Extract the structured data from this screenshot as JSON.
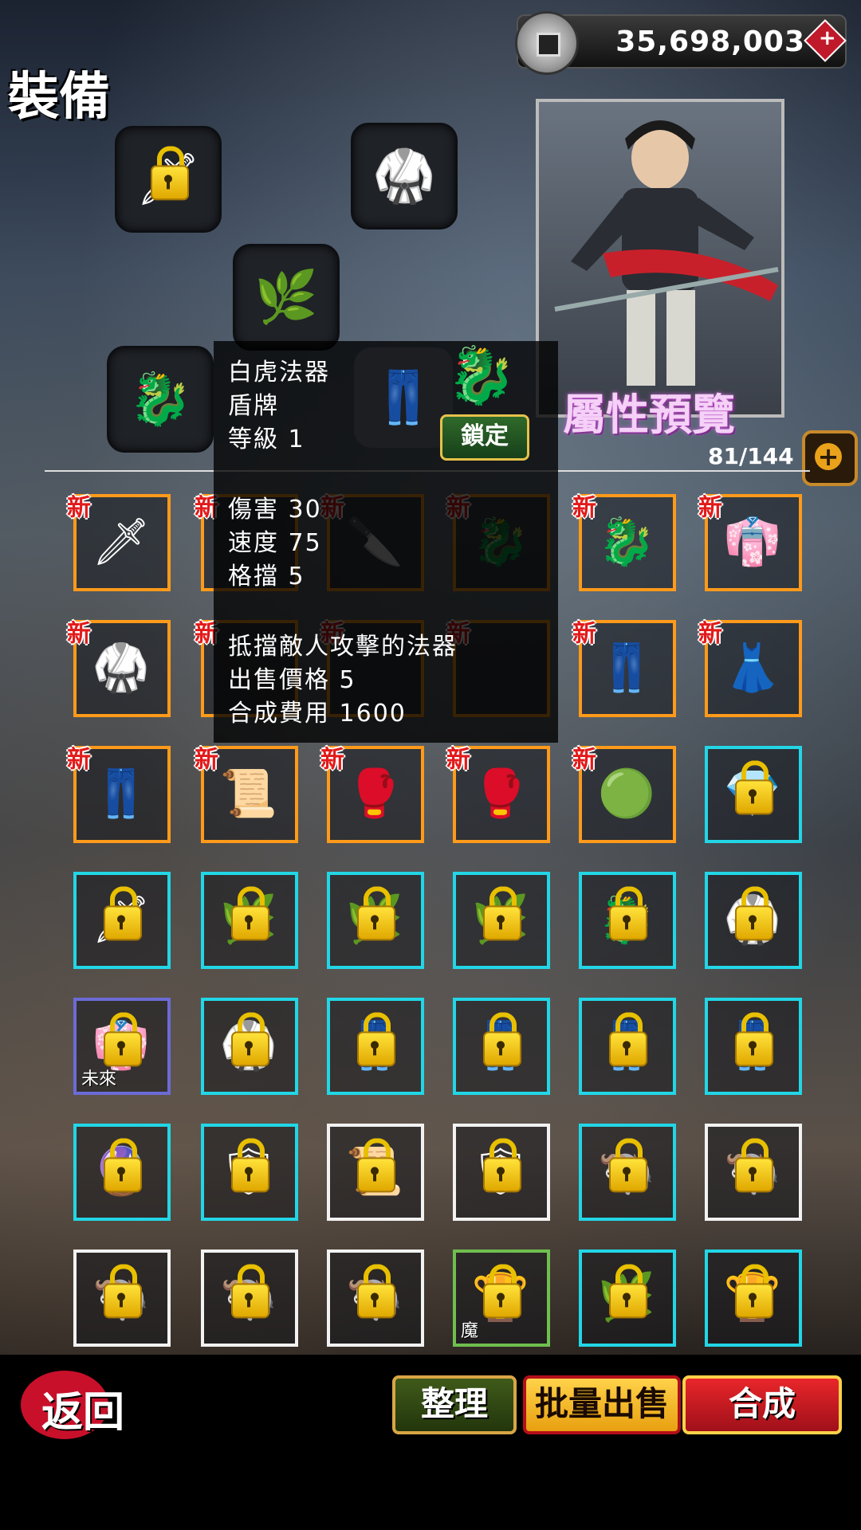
{
  "header": {
    "title": "裝備",
    "currency_value": "35,698,003",
    "currency_add_symbol": "+"
  },
  "equipped": {
    "slots": [
      {
        "icon": "claw-weapon-icon",
        "locked": true,
        "glyph": "🗡"
      },
      {
        "icon": "purple-armor-icon",
        "locked": false,
        "glyph": "🥋"
      },
      {
        "icon": "herb-icon",
        "locked": false,
        "glyph": "🌿"
      },
      {
        "icon": "tiger-talisman-icon",
        "locked": false,
        "glyph": "🐉"
      },
      {
        "icon": "pants-icon",
        "locked": false,
        "glyph": "👖"
      }
    ]
  },
  "hero": {
    "preview_label": "屬性預覽"
  },
  "inventory": {
    "capacity": "81/144",
    "expand_symbol": "+",
    "new_label": "新",
    "rows": [
      [
        {
          "rarity": "orange",
          "new": true,
          "locked": false,
          "icon": "spear-icon",
          "glyph": "🗡",
          "tag": ""
        },
        {
          "rarity": "orange",
          "new": true,
          "locked": false,
          "icon": "item-icon",
          "glyph": "",
          "tag": ""
        },
        {
          "rarity": "orange",
          "new": true,
          "locked": false,
          "icon": "curved-blade-icon",
          "glyph": "🔪",
          "tag": ""
        },
        {
          "rarity": "orange",
          "new": true,
          "locked": false,
          "icon": "tiger-talisman-icon",
          "glyph": "🐉",
          "tag": ""
        },
        {
          "rarity": "orange",
          "new": true,
          "locked": false,
          "icon": "tiger-talisman-icon",
          "glyph": "🐉",
          "tag": ""
        },
        {
          "rarity": "orange",
          "new": true,
          "locked": false,
          "icon": "robe-icon",
          "glyph": "👘",
          "tag": ""
        }
      ],
      [
        {
          "rarity": "orange",
          "new": true,
          "locked": false,
          "icon": "armor-icon",
          "glyph": "🥋",
          "tag": ""
        },
        {
          "rarity": "orange",
          "new": true,
          "locked": false,
          "icon": "item-icon",
          "glyph": "",
          "tag": ""
        },
        {
          "rarity": "orange",
          "new": true,
          "locked": false,
          "icon": "item-icon",
          "glyph": "",
          "tag": ""
        },
        {
          "rarity": "orange",
          "new": true,
          "locked": false,
          "icon": "item-icon",
          "glyph": "",
          "tag": ""
        },
        {
          "rarity": "orange",
          "new": true,
          "locked": false,
          "icon": "pants-icon",
          "glyph": "👖",
          "tag": ""
        },
        {
          "rarity": "orange",
          "new": true,
          "locked": false,
          "icon": "skirt-icon",
          "glyph": "👗",
          "tag": ""
        }
      ],
      [
        {
          "rarity": "orange",
          "new": true,
          "locked": false,
          "icon": "pants-icon",
          "glyph": "👖",
          "tag": ""
        },
        {
          "rarity": "orange",
          "new": true,
          "locked": false,
          "icon": "scroll-icon",
          "glyph": "📜",
          "tag": ""
        },
        {
          "rarity": "orange",
          "new": true,
          "locked": false,
          "icon": "gauntlet-icon",
          "glyph": "🥊",
          "tag": ""
        },
        {
          "rarity": "orange",
          "new": true,
          "locked": false,
          "icon": "gauntlet-icon",
          "glyph": "🥊",
          "tag": ""
        },
        {
          "rarity": "orange",
          "new": true,
          "locked": false,
          "icon": "orb-icon",
          "glyph": "🟢",
          "tag": ""
        },
        {
          "rarity": "cyan",
          "new": false,
          "locked": true,
          "icon": "gem-icon",
          "glyph": "💎",
          "tag": ""
        }
      ],
      [
        {
          "rarity": "cyan",
          "new": false,
          "locked": true,
          "icon": "claw-weapon-icon",
          "glyph": "🗡",
          "tag": ""
        },
        {
          "rarity": "cyan",
          "new": false,
          "locked": true,
          "icon": "herb-icon",
          "glyph": "🌿",
          "tag": ""
        },
        {
          "rarity": "cyan",
          "new": false,
          "locked": true,
          "icon": "herb-icon",
          "glyph": "🌿",
          "tag": ""
        },
        {
          "rarity": "cyan",
          "new": false,
          "locked": true,
          "icon": "herb-icon",
          "glyph": "🌿",
          "tag": ""
        },
        {
          "rarity": "cyan",
          "new": false,
          "locked": true,
          "icon": "tiger-talisman-icon",
          "glyph": "🐉",
          "tag": ""
        },
        {
          "rarity": "cyan",
          "new": false,
          "locked": true,
          "icon": "armor-icon",
          "glyph": "🥋",
          "tag": ""
        }
      ],
      [
        {
          "rarity": "purple",
          "new": false,
          "locked": true,
          "icon": "robe-icon",
          "glyph": "👘",
          "tag": "未來"
        },
        {
          "rarity": "cyan",
          "new": false,
          "locked": true,
          "icon": "armor-icon",
          "glyph": "🥋",
          "tag": ""
        },
        {
          "rarity": "cyan",
          "new": false,
          "locked": true,
          "icon": "pants-icon",
          "glyph": "👖",
          "tag": ""
        },
        {
          "rarity": "cyan",
          "new": false,
          "locked": true,
          "icon": "pants-icon",
          "glyph": "👖",
          "tag": ""
        },
        {
          "rarity": "cyan",
          "new": false,
          "locked": true,
          "icon": "pants-icon",
          "glyph": "👖",
          "tag": ""
        },
        {
          "rarity": "cyan",
          "new": false,
          "locked": true,
          "icon": "pants-icon",
          "glyph": "👖",
          "tag": ""
        }
      ],
      [
        {
          "rarity": "cyan",
          "new": false,
          "locked": true,
          "icon": "crystal-ball-icon",
          "glyph": "🔮",
          "tag": ""
        },
        {
          "rarity": "cyan",
          "new": false,
          "locked": true,
          "icon": "shield-icon",
          "glyph": "🛡",
          "tag": ""
        },
        {
          "rarity": "white",
          "new": false,
          "locked": true,
          "icon": "scroll-icon",
          "glyph": "📜",
          "tag": ""
        },
        {
          "rarity": "white",
          "new": false,
          "locked": true,
          "icon": "shield-icon",
          "glyph": "🛡",
          "tag": ""
        },
        {
          "rarity": "cyan",
          "new": false,
          "locked": true,
          "icon": "ox-icon",
          "glyph": "🐃",
          "tag": ""
        },
        {
          "rarity": "white",
          "new": false,
          "locked": true,
          "icon": "ox-icon",
          "glyph": "🐃",
          "tag": ""
        }
      ],
      [
        {
          "rarity": "white",
          "new": false,
          "locked": true,
          "icon": "ox-icon",
          "glyph": "🐃",
          "tag": ""
        },
        {
          "rarity": "white",
          "new": false,
          "locked": true,
          "icon": "ox-icon",
          "glyph": "🐃",
          "tag": ""
        },
        {
          "rarity": "white",
          "new": false,
          "locked": true,
          "icon": "ox-icon",
          "glyph": "🐃",
          "tag": ""
        },
        {
          "rarity": "green",
          "new": false,
          "locked": true,
          "icon": "ingot-icon",
          "glyph": "🏆",
          "tag": "魔"
        },
        {
          "rarity": "cyan",
          "new": false,
          "locked": true,
          "icon": "herb-icon",
          "glyph": "🌿",
          "tag": ""
        },
        {
          "rarity": "cyan",
          "new": false,
          "locked": true,
          "icon": "ingot-icon",
          "glyph": "🏆",
          "tag": ""
        }
      ]
    ]
  },
  "tooltip": {
    "name": "白虎法器",
    "type": "盾牌",
    "level": "等級 1",
    "damage": "傷害 30",
    "speed": "速度 75",
    "block": "格擋 5",
    "description": "抵擋敵人攻擊的法器",
    "sell_price": "出售價格 5",
    "craft_cost": "合成費用 1600",
    "lock_button": "鎖定"
  },
  "footer": {
    "back_label": "返回",
    "sort_label": "整理",
    "bulk_sell_label": "批量出售",
    "craft_label": "合成"
  }
}
